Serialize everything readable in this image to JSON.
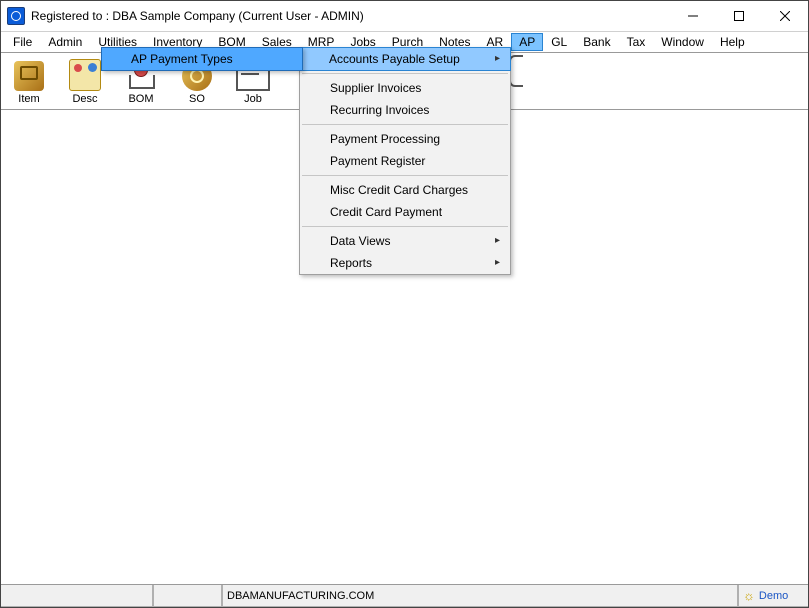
{
  "title": "Registered to : DBA Sample Company (Current User - ADMIN)",
  "menubar": [
    "File",
    "Admin",
    "Utilities",
    "Inventory",
    "BOM",
    "Sales",
    "MRP",
    "Jobs",
    "Purch",
    "Notes",
    "AR",
    "AP",
    "GL",
    "Bank",
    "Tax",
    "Window",
    "Help"
  ],
  "menubar_open": "AP",
  "toolbar": [
    {
      "label": "Item",
      "icon": "ic-item"
    },
    {
      "label": "Desc",
      "icon": "ic-desc"
    },
    {
      "label": "BOM",
      "icon": "ic-bom"
    },
    {
      "label": "SO",
      "icon": "ic-so"
    },
    {
      "label": "Job",
      "icon": "ic-job"
    }
  ],
  "ap_menu": {
    "highlighted": "Accounts Payable Setup",
    "items": [
      {
        "label": "Accounts Payable Setup",
        "submenu": true,
        "hl": true
      },
      {
        "sep": true
      },
      {
        "label": "Supplier Invoices"
      },
      {
        "label": "Recurring Invoices"
      },
      {
        "sep": true
      },
      {
        "label": "Payment Processing"
      },
      {
        "label": "Payment Register"
      },
      {
        "sep": true
      },
      {
        "label": "Misc Credit Card Charges"
      },
      {
        "label": "Credit Card Payment"
      },
      {
        "sep": true
      },
      {
        "label": "Data Views",
        "submenu": true
      },
      {
        "label": "Reports",
        "submenu": true
      }
    ]
  },
  "ap_setup_submenu": {
    "highlighted": "AP Payment Types",
    "items": [
      {
        "label": "AP Payment Types",
        "hl": true
      }
    ]
  },
  "status": {
    "url": "DBAMANUFACTURING.COM",
    "demo": "Demo"
  }
}
